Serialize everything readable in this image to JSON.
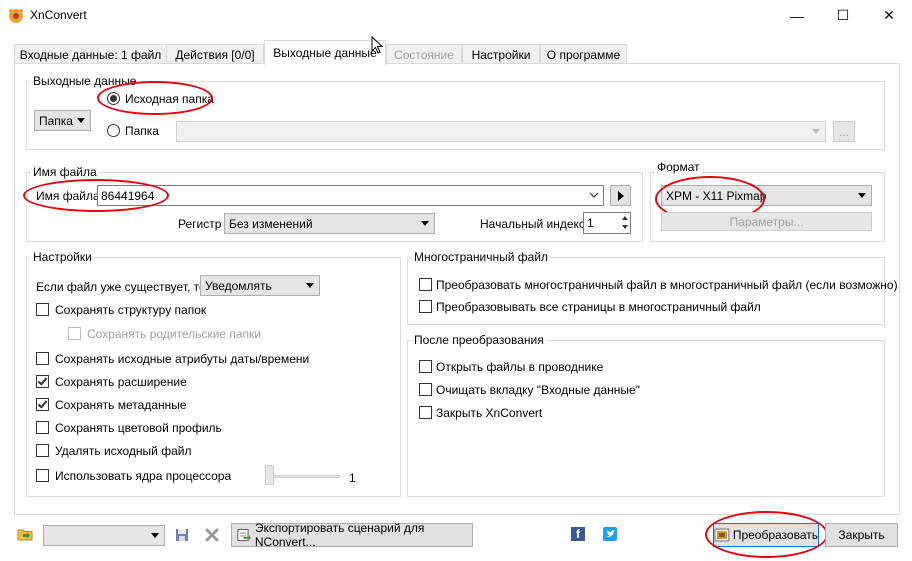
{
  "window": {
    "title": "XnConvert",
    "minimize_glyph": "—",
    "maximize_glyph": "☐",
    "close_glyph": "✕"
  },
  "tabs": [
    {
      "label": "Входные данные: 1 файл"
    },
    {
      "label": "Действия [0/0]"
    },
    {
      "label": "Выходные данные"
    },
    {
      "label": "Состояние"
    },
    {
      "label": "Настройки"
    },
    {
      "label": "О программе"
    }
  ],
  "output": {
    "group_title": "Выходные данные",
    "type_select": "Папка",
    "radio_source": "Исходная папка",
    "radio_folder": "Папка",
    "browse_label": "..."
  },
  "filename": {
    "group_title": "Имя файла",
    "field_label": "Имя файла",
    "value": "86441964",
    "case_label": "Регистр",
    "case_value": "Без изменений",
    "start_index_label": "Начальный индекс",
    "start_index_value": "1"
  },
  "format": {
    "group_title": "Формат",
    "value": "XPM - X11 Pixmap",
    "params_label": "Параметры..."
  },
  "settings": {
    "group_title": "Настройки",
    "if_exists_label": "Если файл уже существует, то",
    "if_exists_value": "Уведомлять",
    "keep_structure": "Сохранять структуру папок",
    "keep_parent": "Сохранять родительские папки",
    "keep_dates": "Сохранять исходные атрибуты даты/времени",
    "keep_ext": "Сохранять расширение",
    "keep_meta": "Сохранять метаданные",
    "keep_profile": "Сохранять цветовой профиль",
    "delete_src": "Удалять исходный файл",
    "use_cores": "Использовать ядра процессора",
    "cores_value": "1"
  },
  "multipage": {
    "group_title": "Многостраничный файл",
    "opt1": "Преобразовать многостраничный файл в многостраничный файл (если возможно)",
    "opt2": "Преобразовывать все страницы в многостраничный файл"
  },
  "after": {
    "group_title": "После преобразования",
    "opt1": "Открыть файлы в проводнике",
    "opt2": "Очищать вкладку \"Входные данные\"",
    "opt3": "Закрыть XnConvert"
  },
  "bottom": {
    "export_label": "Экспортировать сценарий для NConvert...",
    "convert_label": "Преобразовать",
    "close_label": "Закрыть",
    "facebook_glyph": "f"
  },
  "colors": {
    "annotation_red": "#e8000b",
    "accent": "#0078d7",
    "facebook": "#3b5998",
    "twitter": "#1da1f2"
  }
}
